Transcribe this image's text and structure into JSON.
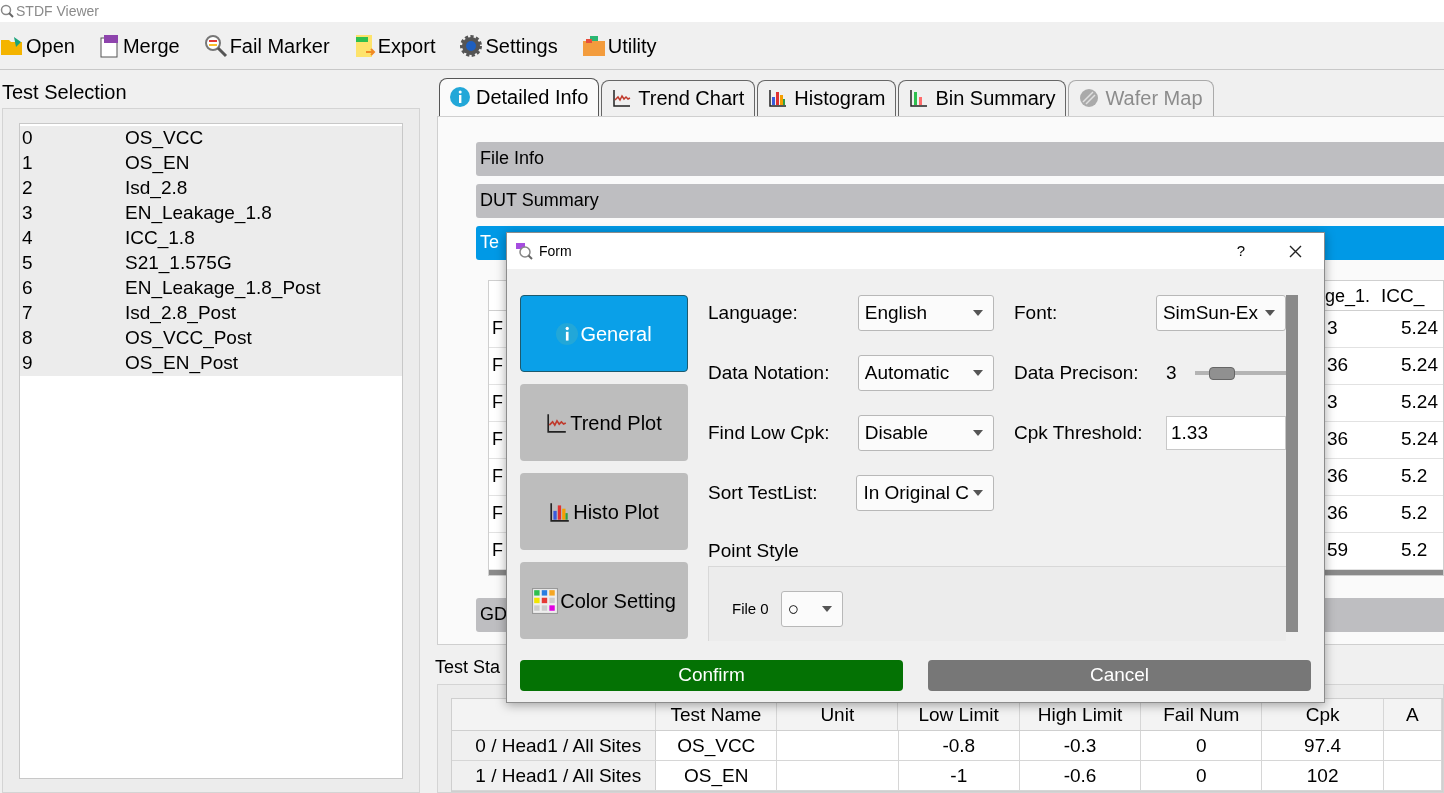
{
  "window": {
    "title": "STDF Viewer"
  },
  "toolbar": [
    {
      "label": "Open",
      "kind": "open"
    },
    {
      "label": "Merge",
      "kind": "merge"
    },
    {
      "label": "Fail Marker",
      "kind": "marker"
    },
    {
      "label": "Export",
      "kind": "export"
    },
    {
      "label": "Settings",
      "kind": "settings"
    },
    {
      "label": "Utility",
      "kind": "utility"
    }
  ],
  "test_selection": {
    "title": "Test Selection",
    "items": [
      {
        "index": "0",
        "name": "OS_VCC"
      },
      {
        "index": "1",
        "name": "OS_EN"
      },
      {
        "index": "2",
        "name": "Isd_2.8"
      },
      {
        "index": "3",
        "name": "EN_Leakage_1.8"
      },
      {
        "index": "4",
        "name": "ICC_1.8"
      },
      {
        "index": "5",
        "name": "S21_1.575G"
      },
      {
        "index": "6",
        "name": "EN_Leakage_1.8_Post"
      },
      {
        "index": "7",
        "name": "Isd_2.8_Post"
      },
      {
        "index": "8",
        "name": "OS_VCC_Post"
      },
      {
        "index": "9",
        "name": "OS_EN_Post"
      }
    ]
  },
  "tabs": [
    {
      "label": "Detailed Info",
      "kind": "info",
      "selected": true,
      "disabled": false
    },
    {
      "label": "Trend Chart",
      "kind": "trend",
      "selected": false,
      "disabled": false
    },
    {
      "label": "Histogram",
      "kind": "histo",
      "selected": false,
      "disabled": false
    },
    {
      "label": "Bin Summary",
      "kind": "bins",
      "selected": false,
      "disabled": false
    },
    {
      "label": "Wafer Map",
      "kind": "wafer",
      "selected": false,
      "disabled": true
    }
  ],
  "sections": [
    {
      "title": "File Info",
      "expanded": false
    },
    {
      "title": "DUT Summary",
      "expanded": false
    },
    {
      "title": "Te",
      "expanded": true
    },
    {
      "title": "GD",
      "expanded": false
    }
  ],
  "detail_table": {
    "columns": [
      "ge_1.",
      "ICC_"
    ],
    "rows": [
      {
        "column_1": "F",
        "column_2": "3",
        "column_3": "5.24"
      },
      {
        "column_1": "F",
        "column_2": "36",
        "column_3": "5.24"
      },
      {
        "column_1": "F",
        "column_2": "3",
        "column_3": "5.24"
      },
      {
        "column_1": "F",
        "column_2": "36",
        "column_3": "5.24"
      },
      {
        "column_1": "F",
        "column_2": "36",
        "column_3": "5.2"
      },
      {
        "column_1": "F",
        "column_2": "36",
        "column_3": "5.2"
      },
      {
        "column_1": "F",
        "column_2": "59",
        "column_3": "5.2"
      }
    ]
  },
  "test_statistics": {
    "title": "Test Sta",
    "columns": [
      "Test Name",
      "Unit",
      "Low Limit",
      "High Limit",
      "Fail Num",
      "Cpk",
      "A"
    ],
    "rows": [
      {
        "site": "0 / Head1 / All Sites",
        "test_name": "OS_VCC",
        "low_limit": "-0.8",
        "high_limit": "-0.3",
        "fail_num": "0",
        "cpk": "97.4"
      },
      {
        "site": "1 / Head1 / All Sites",
        "test_name": "OS_EN",
        "low_limit": "-1",
        "high_limit": "-0.6",
        "fail_num": "0",
        "cpk": "102"
      }
    ]
  },
  "dialog": {
    "title": "Form",
    "help": "?",
    "nav": [
      {
        "label": "General",
        "kind": "info",
        "selected": true
      },
      {
        "label": "Trend Plot",
        "kind": "trend",
        "selected": false
      },
      {
        "label": "Histo Plot",
        "kind": "histo",
        "selected": false
      },
      {
        "label": "Color Setting",
        "kind": "color",
        "selected": false
      }
    ],
    "settings": [
      {
        "label": "Language:",
        "kind": "combo",
        "value": "English"
      },
      {
        "label": "Font:",
        "kind": "combo",
        "value": "SimSun-Ex"
      },
      {
        "label": "Data Notation:",
        "kind": "combo",
        "value": "Automatic"
      },
      {
        "label": "Data Precison:",
        "kind": "slider",
        "reading": "3",
        "level": 0.3
      },
      {
        "label": "Find Low Cpk:",
        "kind": "combo",
        "value": "Disable"
      },
      {
        "label": "Cpk Threshold:",
        "kind": "input",
        "value": "1.33"
      },
      {
        "label": "Sort TestList:",
        "kind": "combo",
        "value": "In Original C"
      }
    ],
    "point_style": {
      "title": "Point Style",
      "files": [
        {
          "label": "File 0",
          "value": "○"
        }
      ]
    },
    "buttons": [
      {
        "label": "Confirm",
        "kind": "confirm"
      },
      {
        "label": "Cancel",
        "kind": "cancel"
      }
    ]
  }
}
